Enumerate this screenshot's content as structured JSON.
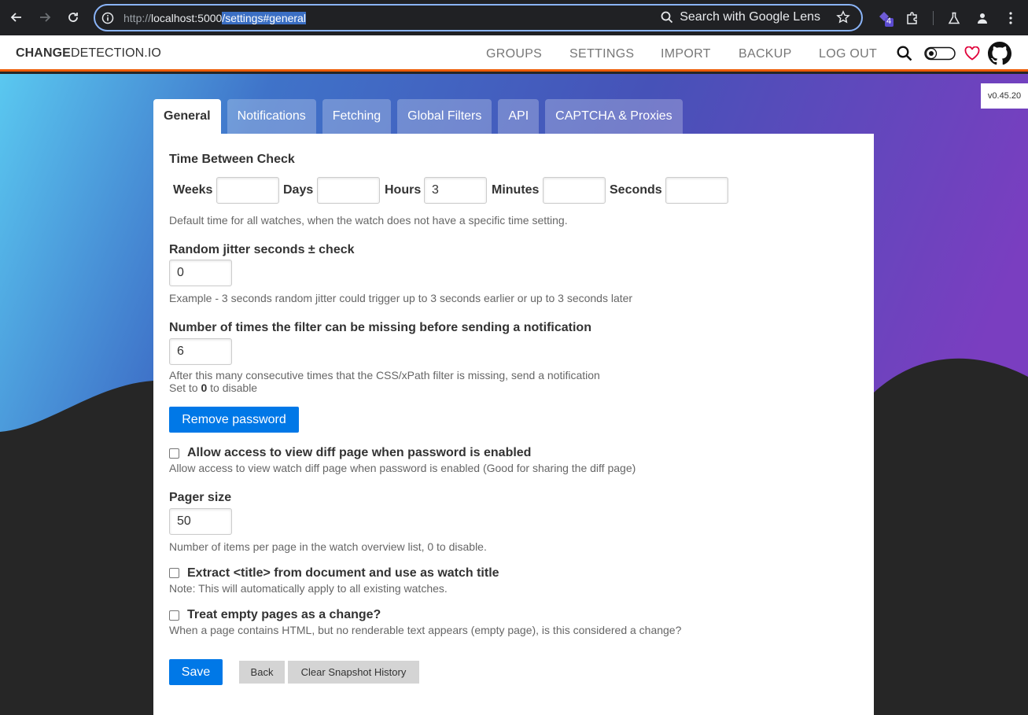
{
  "browser": {
    "url_prefix": "http://",
    "url_host": "localhost:5000",
    "url_path": "/settings#general",
    "lens_label": "Search with Google Lens",
    "ext_badge": "4"
  },
  "site": {
    "brand_bold": "CHANGE",
    "brand_rest": "DETECTION.IO",
    "menu": [
      "GROUPS",
      "SETTINGS",
      "IMPORT",
      "BACKUP",
      "LOG OUT"
    ],
    "version": "v0.45.20",
    "accent": "#ed5900"
  },
  "tabs": [
    "General",
    "Notifications",
    "Fetching",
    "Global Filters",
    "API",
    "CAPTCHA & Proxies"
  ],
  "form": {
    "time_between_check": {
      "label": "Time Between Check",
      "weeks_label": "Weeks",
      "weeks_value": "",
      "days_label": "Days",
      "days_value": "",
      "hours_label": "Hours",
      "hours_value": "3",
      "minutes_label": "Minutes",
      "minutes_value": "",
      "seconds_label": "Seconds",
      "seconds_value": "",
      "help": "Default time for all watches, when the watch does not have a specific time setting."
    },
    "jitter": {
      "label": "Random jitter seconds ± check",
      "value": "0",
      "help": "Example - 3 seconds random jitter could trigger up to 3 seconds earlier or up to 3 seconds later"
    },
    "filter_missing": {
      "label": "Number of times the filter can be missing before sending a notification",
      "value": "6",
      "help": "After this many consecutive times that the CSS/xPath filter is missing, send a notification",
      "help2_pre": "Set to ",
      "help2_bold": "0",
      "help2_post": " to disable"
    },
    "remove_password_label": "Remove password",
    "allow_diff": {
      "label": "Allow access to view diff page when password is enabled",
      "help": "Allow access to view watch diff page when password is enabled (Good for sharing the diff page)",
      "checked": false
    },
    "pager": {
      "label": "Pager size",
      "value": "50",
      "help": "Number of items per page in the watch overview list, 0 to disable."
    },
    "extract_title": {
      "label": "Extract <title> from document and use as watch title",
      "help": "Note: This will automatically apply to all existing watches.",
      "checked": false
    },
    "empty_pages": {
      "label": "Treat empty pages as a change?",
      "help": "When a page contains HTML, but no renderable text appears (empty page), is this considered a change?",
      "checked": false
    },
    "save_label": "Save",
    "back_label": "Back",
    "clear_label": "Clear Snapshot History"
  }
}
